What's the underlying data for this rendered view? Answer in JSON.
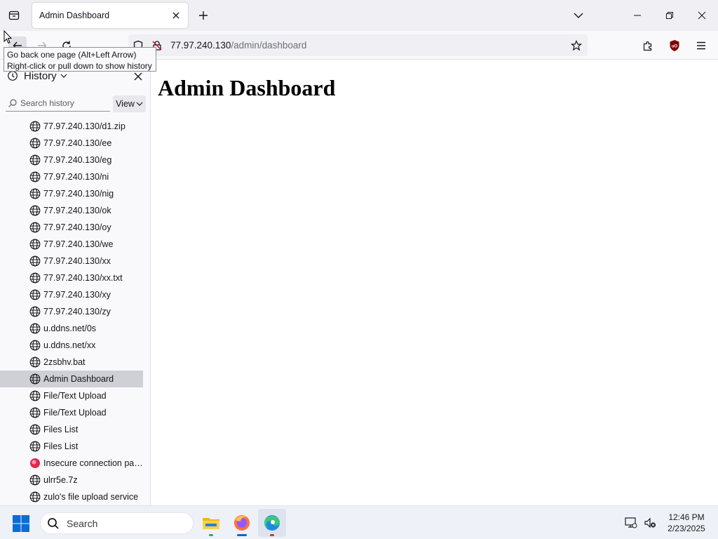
{
  "browser": {
    "tab": {
      "title": "Admin Dashboard"
    },
    "url": {
      "host": "77.97.240.130",
      "path": "/admin/dashboard"
    },
    "tooltip": {
      "line1": "Go back one page (Alt+Left Arrow)",
      "line2": "Right-click or pull down to show history"
    }
  },
  "sidebar": {
    "title": "History",
    "search_placeholder": "Search history",
    "view_label": "View",
    "items": [
      {
        "label": "77.97.240.130/d1.zip",
        "icon": "globe-icon"
      },
      {
        "label": "77.97.240.130/ee",
        "icon": "globe-icon"
      },
      {
        "label": "77.97.240.130/eg",
        "icon": "globe-icon"
      },
      {
        "label": "77.97.240.130/ni",
        "icon": "globe-icon"
      },
      {
        "label": "77.97.240.130/nig",
        "icon": "globe-icon"
      },
      {
        "label": "77.97.240.130/ok",
        "icon": "globe-icon"
      },
      {
        "label": "77.97.240.130/oy",
        "icon": "globe-icon"
      },
      {
        "label": "77.97.240.130/we",
        "icon": "globe-icon"
      },
      {
        "label": "77.97.240.130/xx",
        "icon": "globe-icon"
      },
      {
        "label": "77.97.240.130/xx.txt",
        "icon": "globe-icon"
      },
      {
        "label": "77.97.240.130/xy",
        "icon": "globe-icon"
      },
      {
        "label": "77.97.240.130/zy",
        "icon": "globe-icon"
      },
      {
        "label": "u.ddns.net/0s",
        "icon": "globe-icon"
      },
      {
        "label": "u.ddns.net/xx",
        "icon": "globe-icon"
      },
      {
        "label": "2zsbhv.bat",
        "icon": "globe-icon"
      },
      {
        "label": "Admin Dashboard",
        "icon": "globe-icon",
        "selected": true
      },
      {
        "label": "File/Text Upload",
        "icon": "globe-icon"
      },
      {
        "label": "File/Text Upload",
        "icon": "globe-icon"
      },
      {
        "label": "Files List",
        "icon": "globe-icon"
      },
      {
        "label": "Files List",
        "icon": "globe-icon"
      },
      {
        "label": "Insecure connection pass...",
        "icon": "warning-favicon-icon"
      },
      {
        "label": "ulrr5e.7z",
        "icon": "globe-icon"
      },
      {
        "label": "zulo's file upload service",
        "icon": "globe-icon"
      }
    ]
  },
  "page": {
    "heading": "Admin Dashboard"
  },
  "taskbar": {
    "search_label": "Search",
    "time": "12:46 PM",
    "date": "2/23/2025"
  },
  "colors": {
    "selected_row": "#cfcfd6",
    "firefox_indicator": "#0a64d6",
    "edge_indicator": "#d0342c",
    "explorer_indicator": "#37a75a"
  }
}
